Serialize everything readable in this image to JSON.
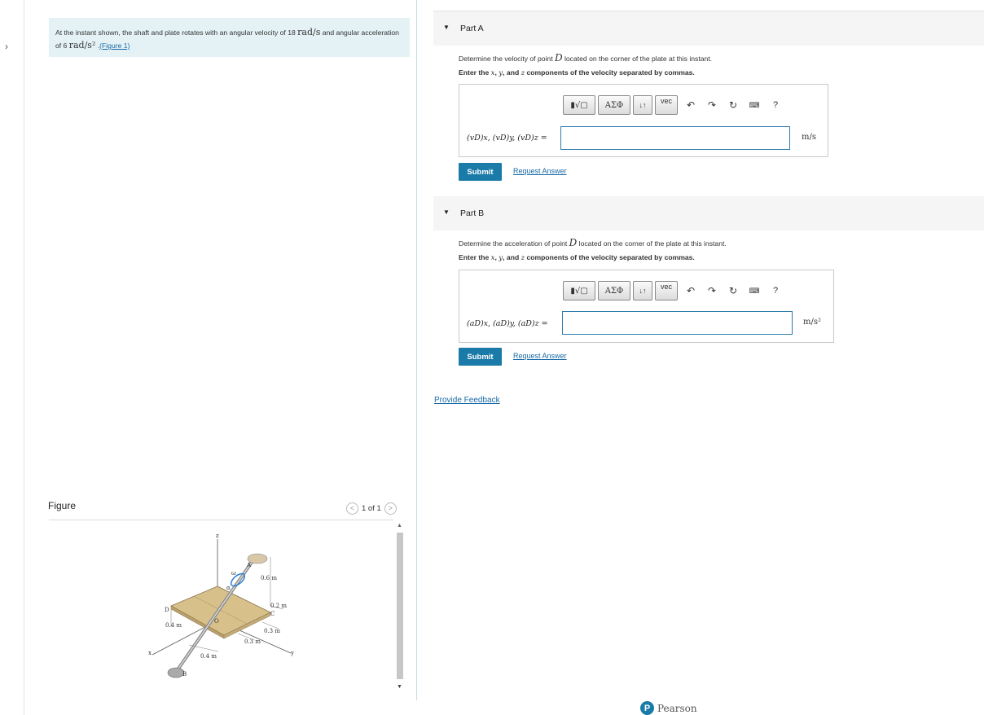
{
  "nav": {
    "expand_arrow": "›"
  },
  "problem": {
    "text_before": "At the instant shown, the shaft and plate rotates with an angular velocity of 18 ",
    "omega_unit": "rad/s",
    "text_mid": " and angular acceleration of 6 ",
    "alpha_unit": "rad/s²",
    "text_after": " .",
    "figure_link": "(Figure 1)"
  },
  "figure": {
    "title": "Figure",
    "pager": "1 of 1",
    "prev": "<",
    "next": ">",
    "labels": {
      "z": "z",
      "x": "x",
      "y": "y",
      "A": "A",
      "B": "B",
      "C": "C",
      "D": "D",
      "O": "O",
      "omega": "ω",
      "alpha": "α",
      "d06": "0.6 m",
      "d02": "0.2 m",
      "d03a": "0.3 m",
      "d03b": "0.3 m",
      "d04a": "0.4 m",
      "d04b": "0.4 m"
    }
  },
  "partA": {
    "label": "Part A",
    "question_before": "Determine the velocity of point ",
    "point": "D",
    "question_after": " located on the corner of the plate at this instant.",
    "instruction_before": "Enter the ",
    "x": "x",
    "y": "y",
    "z": "z",
    "instruction_after": " components of the velocity separated by commas.",
    "sep1": ", ",
    "sep2": ", and ",
    "eq_label": "(vD)x, (vD)y, (vD)z =",
    "input_value": "",
    "unit": "m/s",
    "submit": "Submit",
    "request": "Request Answer"
  },
  "partB": {
    "label": "Part B",
    "question_before": "Determine the acceleration of point ",
    "point": "D",
    "question_after": " located on the corner of the plate at this instant.",
    "instruction_before": "Enter the ",
    "x": "x",
    "y": "y",
    "z": "z",
    "instruction_after": " components of the velocity separated by commas.",
    "sep1": ", ",
    "sep2": ", and ",
    "eq_label": "(aD)x, (aD)y, (aD)z =",
    "input_value": "",
    "unit": "m/s²",
    "submit": "Submit",
    "request": "Request Answer"
  },
  "toolbar": {
    "templates": "▮√▢",
    "greek": "ΑΣΦ",
    "arrows": "↓↑",
    "vec": "vec",
    "undo": "↶",
    "redo": "↷",
    "reset": "↻",
    "keyboard": "⌨",
    "help": "?"
  },
  "footer": {
    "feedback": "Provide Feedback",
    "brand_letter": "P",
    "brand": "Pearson"
  },
  "colors": {
    "accent": "#1a7ba8",
    "link": "#1769a6",
    "intro_bg": "#e4f2f6",
    "plate": "#d8c08a"
  }
}
